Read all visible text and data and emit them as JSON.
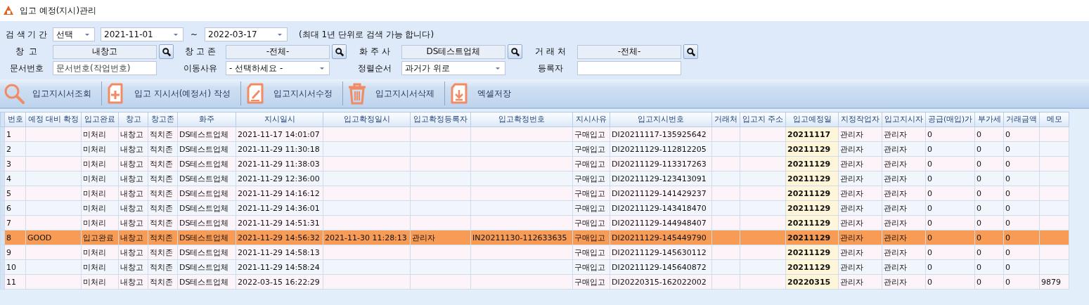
{
  "window": {
    "title": "입고 예정(지시)관리"
  },
  "period": {
    "label": "검 색 기 간",
    "mode": "선택",
    "from": "2021-11-01",
    "separator": "~",
    "to": "2022-03-17",
    "note": "(최대 1년 단위로 검색 가능 합니다)"
  },
  "fields": [
    {
      "label": "창  고",
      "kind": "lookup",
      "value": "내창고"
    },
    {
      "label": "창 고 존",
      "kind": "lookup",
      "value": "-전체-"
    },
    {
      "label": "화 주 사",
      "kind": "lookup",
      "value": "DS테스트업체"
    },
    {
      "label": "거 래 처",
      "kind": "lookup",
      "value": "-전체-"
    },
    {
      "label": "문서번호",
      "kind": "text",
      "placeholder": "문서번호(작업번호)"
    },
    {
      "label": "이동사유",
      "kind": "select",
      "value": "- 선택하세요 -"
    },
    {
      "label": "정렬순서",
      "kind": "select",
      "value": "과거가 위로"
    },
    {
      "label": "등록자",
      "kind": "text"
    }
  ],
  "toolbar": [
    {
      "label": "입고지시서조회",
      "kind": "search"
    },
    {
      "label": "입고 지시서(예정서) 작성",
      "kind": "add"
    },
    {
      "label": "입고지시서수정",
      "kind": "edit"
    },
    {
      "label": "입고지시서삭제",
      "kind": "delete"
    },
    {
      "label": "엑셀저장",
      "kind": "excel"
    }
  ],
  "table": {
    "columns": [
      {
        "label": "번호",
        "bold": false
      },
      {
        "label": "예정 대비 확정",
        "bold": false
      },
      {
        "label": "입고완료",
        "bold": false
      },
      {
        "label": "창고",
        "bold": false
      },
      {
        "label": "창고존",
        "bold": false
      },
      {
        "label": "화주",
        "bold": false
      },
      {
        "label": "지시일시",
        "bold": false
      },
      {
        "label": "입고확정일시",
        "bold": false
      },
      {
        "label": "입고확정등록자",
        "bold": false
      },
      {
        "label": "입고확정번호",
        "bold": false
      },
      {
        "label": "지시사유",
        "bold": false
      },
      {
        "label": "입고지시번호",
        "bold": false
      },
      {
        "label": "거래처",
        "bold": false
      },
      {
        "label": "입고지 주소",
        "bold": false
      },
      {
        "label": "입고예정일",
        "bold": true
      },
      {
        "label": "지정작업자",
        "bold": false
      },
      {
        "label": "입고지시자",
        "bold": false
      },
      {
        "label": "공급(매입)가",
        "bold": false
      },
      {
        "label": "부가세",
        "bold": false
      },
      {
        "label": "거래금액",
        "bold": false
      },
      {
        "label": "메모",
        "bold": false
      }
    ],
    "rows": [
      {
        "selected": false,
        "cells": [
          "1",
          null,
          "미처리",
          "내창고",
          "적치존",
          "DS테스트업체",
          "2021-11-17 14:01:07",
          null,
          null,
          null,
          "구매입고",
          "DI20211117-135925642",
          null,
          null,
          "20211117",
          "관리자",
          "관리자",
          "0",
          "0",
          "0",
          null
        ]
      },
      {
        "selected": false,
        "cells": [
          "2",
          null,
          "미처리",
          "내창고",
          "적치존",
          "DS테스트업체",
          "2021-11-29 11:30:18",
          null,
          null,
          null,
          "구매입고",
          "DI20211129-112812205",
          null,
          null,
          "20211129",
          "관리자",
          "관리자",
          "0",
          "0",
          "0",
          null
        ]
      },
      {
        "selected": false,
        "cells": [
          "3",
          null,
          "미처리",
          "내창고",
          "적치존",
          "DS테스트업체",
          "2021-11-29 11:38:03",
          null,
          null,
          null,
          "구매입고",
          "DI20211129-113317263",
          null,
          null,
          "20211129",
          "관리자",
          "관리자",
          "0",
          "0",
          "0",
          null
        ]
      },
      {
        "selected": false,
        "cells": [
          "4",
          null,
          "미처리",
          "내창고",
          "적치존",
          "DS테스트업체",
          "2021-11-29 12:36:00",
          null,
          null,
          null,
          "구매입고",
          "DI20211129-123413091",
          null,
          null,
          "20211129",
          "관리자",
          "관리자",
          "0",
          "0",
          "0",
          null
        ]
      },
      {
        "selected": false,
        "cells": [
          "5",
          null,
          "미처리",
          "내창고",
          "적치존",
          "DS테스트업체",
          "2021-11-29 14:16:12",
          null,
          null,
          null,
          "구매입고",
          "DI20211129-141429237",
          null,
          null,
          "20211129",
          "관리자",
          "관리자",
          "0",
          "0",
          "0",
          null
        ]
      },
      {
        "selected": false,
        "cells": [
          "6",
          null,
          "미처리",
          "내창고",
          "적치존",
          "DS테스트업체",
          "2021-11-29 14:36:01",
          null,
          null,
          null,
          "구매입고",
          "DI20211129-143418470",
          null,
          null,
          "20211129",
          "관리자",
          "관리자",
          "0",
          "0",
          "0",
          null
        ]
      },
      {
        "selected": false,
        "cells": [
          "7",
          null,
          "미처리",
          "내창고",
          "적치존",
          "DS테스트업체",
          "2021-11-29 14:51:31",
          null,
          null,
          null,
          "구매입고",
          "DI20211129-144948407",
          null,
          null,
          "20211129",
          "관리자",
          "관리자",
          "0",
          "0",
          "0",
          null
        ]
      },
      {
        "selected": true,
        "cells": [
          "8",
          "GOOD",
          "입고완료",
          "내창고",
          "적치존",
          "DS테스트업체",
          "2021-11-29 14:56:32",
          "2021-11-30 11:28:13",
          "관리자",
          "IN20211130-112633635",
          "구매입고",
          "DI20211129-145449790",
          null,
          null,
          "20211129",
          "관리자",
          "관리자",
          "0",
          "0",
          "0",
          null
        ]
      },
      {
        "selected": false,
        "cells": [
          "9",
          null,
          "미처리",
          "내창고",
          "적치존",
          "DS테스트업체",
          "2021-11-29 14:58:13",
          null,
          null,
          null,
          "구매입고",
          "DI20211129-145630112",
          null,
          null,
          "20211129",
          "관리자",
          "관리자",
          "0",
          "0",
          "0",
          null
        ]
      },
      {
        "selected": false,
        "cells": [
          "10",
          null,
          "미처리",
          "내창고",
          "적치존",
          "DS테스트업체",
          "2021-11-29 14:58:24",
          null,
          null,
          null,
          "구매입고",
          "DI20211129-145640872",
          null,
          null,
          "20211129",
          "관리자",
          "관리자",
          "0",
          "0",
          "0",
          null
        ]
      },
      {
        "selected": false,
        "cells": [
          "11",
          null,
          "미처리",
          "내창고",
          "적치존",
          "DS테스트업체",
          "2022-03-15 16:22:29",
          null,
          null,
          null,
          "구매입고",
          "DI20220315-162022002",
          null,
          null,
          "20220315",
          "관리자",
          "관리자",
          "0",
          "0",
          "0",
          "9879"
        ]
      }
    ]
  }
}
